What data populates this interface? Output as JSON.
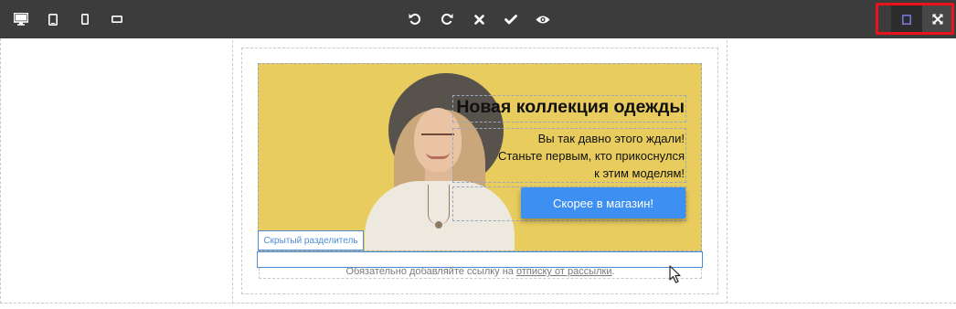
{
  "toolbar": {
    "left_buttons": [
      {
        "icon": "desktop-icon"
      },
      {
        "icon": "tablet-icon"
      },
      {
        "icon": "mobile-portrait-icon"
      },
      {
        "icon": "mobile-landscape-icon"
      }
    ],
    "center_buttons": [
      {
        "icon": "undo-icon"
      },
      {
        "icon": "redo-icon"
      },
      {
        "icon": "clear-icon"
      },
      {
        "icon": "apply-icon"
      },
      {
        "icon": "preview-eye-icon"
      }
    ],
    "right_buttons": [
      {
        "icon": "show-borders-icon"
      },
      {
        "icon": "fullscreen-icon"
      }
    ],
    "highlight_color": "#e8141b"
  },
  "banner": {
    "title": "Новая коллекция одежды",
    "text_lines": [
      "Вы так давно этого ждали!",
      "Станьте первым, кто прикоснулся",
      "к этим моделям!"
    ],
    "cta_label": "Скорее в магазин!",
    "background_color": "#e8cc5e",
    "cta_color": "#3d8ff2"
  },
  "hidden_divider": {
    "label": "Скрытый разделитель",
    "accent_color": "#4d8dd6"
  },
  "footer": {
    "prefix": "Обязательно добавляйте ссылку на ",
    "link": "отписку от рассылки",
    "suffix": "."
  }
}
